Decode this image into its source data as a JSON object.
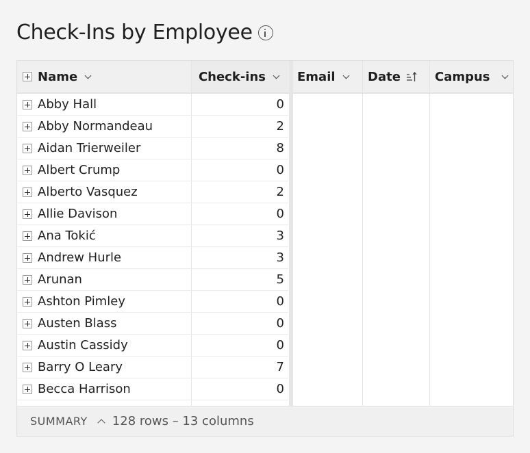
{
  "page": {
    "title": "Check-Ins by Employee"
  },
  "table": {
    "columns": {
      "name": "Name",
      "checkins": "Check-ins",
      "email": "Email",
      "date": "Date",
      "campus": "Campus"
    },
    "rows": [
      {
        "name": "Abby Hall",
        "checkins": "0"
      },
      {
        "name": "Abby Normandeau",
        "checkins": "2"
      },
      {
        "name": "Aidan Trierweiler",
        "checkins": "8"
      },
      {
        "name": "Albert Crump",
        "checkins": "0"
      },
      {
        "name": "Alberto Vasquez",
        "checkins": "2"
      },
      {
        "name": "Allie Davison",
        "checkins": "0"
      },
      {
        "name": "Ana Tokić",
        "checkins": "3"
      },
      {
        "name": "Andrew Hurle",
        "checkins": "3"
      },
      {
        "name": "Arunan",
        "checkins": "5"
      },
      {
        "name": "Ashton Pimley",
        "checkins": "0"
      },
      {
        "name": "Austen Blass",
        "checkins": "0"
      },
      {
        "name": "Austin Cassidy",
        "checkins": "0"
      },
      {
        "name": "Barry O Leary",
        "checkins": "7"
      },
      {
        "name": "Becca Harrison",
        "checkins": "0"
      }
    ]
  },
  "summary": {
    "label": "SUMMARY",
    "text": "128 rows – 13 columns"
  }
}
